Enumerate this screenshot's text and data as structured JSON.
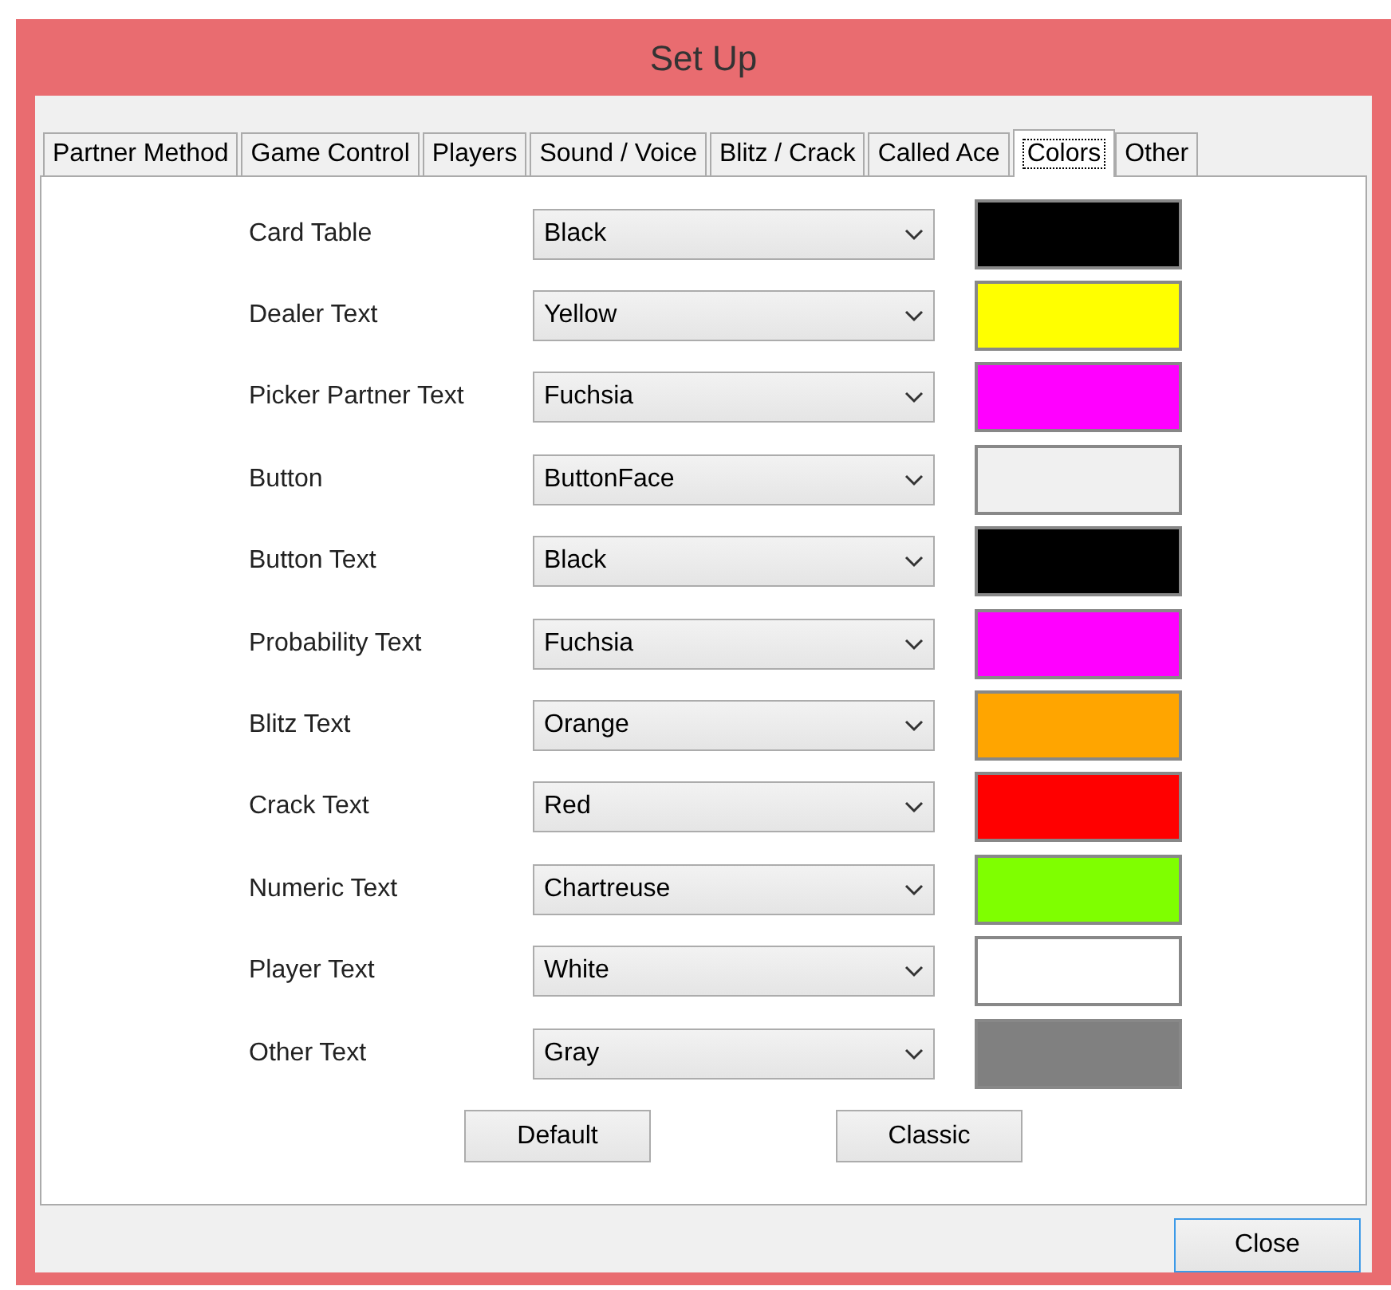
{
  "window": {
    "title": "Set Up"
  },
  "tabs": [
    {
      "label": "Partner Method",
      "selected": false
    },
    {
      "label": "Game Control",
      "selected": false
    },
    {
      "label": "Players",
      "selected": false
    },
    {
      "label": "Sound / Voice",
      "selected": false
    },
    {
      "label": "Blitz / Crack",
      "selected": false
    },
    {
      "label": "Called Ace",
      "selected": false
    },
    {
      "label": "Colors",
      "selected": true
    },
    {
      "label": "Other",
      "selected": false
    }
  ],
  "color_settings": [
    {
      "label": "Card Table",
      "value": "Black",
      "color": "#000000"
    },
    {
      "label": "Dealer Text",
      "value": "Yellow",
      "color": "#ffff00"
    },
    {
      "label": "Picker Partner Text",
      "value": "Fuchsia",
      "color": "#ff00ff"
    },
    {
      "label": "Button",
      "value": "ButtonFace",
      "color": "#f0f0f0"
    },
    {
      "label": "Button Text",
      "value": "Black",
      "color": "#000000"
    },
    {
      "label": "Probability Text",
      "value": "Fuchsia",
      "color": "#ff00ff"
    },
    {
      "label": "Blitz Text",
      "value": "Orange",
      "color": "#ffa500"
    },
    {
      "label": "Crack Text",
      "value": "Red",
      "color": "#ff0000"
    },
    {
      "label": "Numeric Text",
      "value": "Chartreuse",
      "color": "#7fff00"
    },
    {
      "label": "Player Text",
      "value": "White",
      "color": "#ffffff"
    },
    {
      "label": "Other Text",
      "value": "Gray",
      "color": "#808080"
    }
  ],
  "panel_buttons": [
    "Default",
    "Classic"
  ],
  "close_button": "Close"
}
